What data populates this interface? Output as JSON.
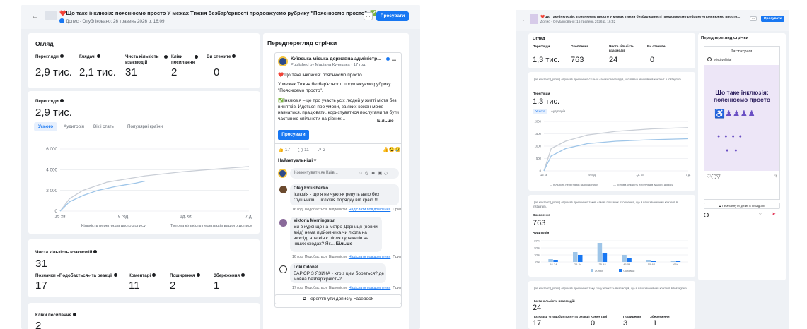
{
  "left": {
    "header": {
      "back": "←",
      "title": "❤️Що таке інклюзія: пояснюємо просто У межах Тижня безбар'єрності продовжуємо рубрику \"Пояснюємо просто\". ✅",
      "subtitle": "Допис · Опубліковано: 26 травень 2026 р. 16:09",
      "more": "...",
      "boost": "Просувати"
    },
    "overview": {
      "title": "Огляд",
      "metrics": [
        {
          "label": "Перегляди",
          "value": "2,9 тис."
        },
        {
          "label": "Глядачі",
          "value": "2,1 тис."
        },
        {
          "label": "Чиста кількість взаємодій",
          "value": "31"
        },
        {
          "label": "Кліки посилання",
          "value": "2"
        },
        {
          "label": "Ви стежите",
          "value": "0"
        }
      ]
    },
    "views_card": {
      "label": "Перегляди",
      "value": "2,9 тис.",
      "tabs": [
        "Усього",
        "Аудиторія",
        "Вік і стать",
        "Популярні країни"
      ],
      "active_tab": "Усього"
    },
    "chart_data": {
      "type": "line",
      "x_ticks": [
        "15 хв",
        "9 год",
        "1д. 6г.",
        "7 д."
      ],
      "y_ticks": [
        "0",
        "2 000",
        "4 000",
        "6 000"
      ],
      "ylim": [
        0,
        6000
      ],
      "series": [
        {
          "name": "Кількість переглядів цього допису",
          "color": "#9ec5e8",
          "x": [
            0,
            0.05,
            0.12,
            0.2,
            0.3,
            0.4,
            0.45
          ],
          "values": [
            0,
            900,
            1500,
            2000,
            2400,
            2700,
            2900
          ]
        },
        {
          "name": "Типова кількість переглядів вашого допису",
          "color": "#c9ced6",
          "x": [
            0,
            0.05,
            0.12,
            0.25,
            0.45,
            0.65,
            0.85,
            1.0
          ],
          "values": [
            0,
            1200,
            2000,
            2800,
            3400,
            3800,
            4100,
            4300
          ]
        }
      ]
    },
    "interactions": {
      "title": "Чиста кількість взаємодій",
      "value": "31",
      "metrics": [
        {
          "label": "Позначки «Подобається» та реакції",
          "value": "17"
        },
        {
          "label": "Коментарі",
          "value": "11"
        },
        {
          "label": "Поширення",
          "value": "2"
        },
        {
          "label": "Збереження",
          "value": "1"
        }
      ]
    },
    "link_clicks": {
      "title": "Кліки посилання",
      "value": "2"
    },
    "preview": {
      "title": "Передперегляд стрічки",
      "page_name": "Київська міська державна адміністр...",
      "published_by": "Published by Маріана Куницька",
      "time": "17 год.",
      "post_lines": [
        "❤️Що таке інклюзія: пояснюємо просто",
        "У межах Тижня безбар'єрності продовжуємо рубрику \"Пояснюємо просто\".",
        "✅Інклюзія – це про участь усіх людей у житті міста без винятків. Йдеться про умови, за яких кожен може навчатися, працювати, користуватися послугами та бути частиною спільноти на рівних..."
      ],
      "more_text": "Більше",
      "boost": "Просувати",
      "likes": "17",
      "comments": "11",
      "shares": "2",
      "sort": "Найактуальніші",
      "comment_placeholder": "Коментувати як Київ...",
      "comments_list": [
        {
          "name": "Oleg Evtushenko",
          "text": "Іклюзія - що я не чую як ревуть авто без глушників ... іклюзія порядку від краю !!!",
          "time": "16 год",
          "like": "Подобається",
          "reply": "Відповісти",
          "hide": "Надіслати повідомлення",
          "more": "Прих"
        },
        {
          "name": "Viktoria Morningstar",
          "text": "Ви в курсі що на метро Дарниця (новий вхід) нема підйомника чи ліфта на вихоід, але він є після турнікетів на інших сходах? Як...",
          "more_text": "Більше",
          "time": "16 год",
          "like": "Подобається",
          "reply": "Відповісти",
          "hide": "Надіслати повідомлення",
          "more": "Прих"
        },
        {
          "name": "Loki Odonel",
          "text": "БАР'ЄР З ЯЗИКА - хто з цим бореться? де мовна безбар'єрність?",
          "time": "17 год",
          "like": "Подобається",
          "reply": "Відповісти",
          "hide": "Надіслати повідомлення",
          "more": "Прих"
        }
      ],
      "view_on_fb": "Переглянути допис у Facebook"
    }
  },
  "right": {
    "header": {
      "title": "❤️Що таке інклюзія: пояснюємо просто У межах Тижня безбар'єрності продовжуємо рубрику «Пояснюємо просто...",
      "subtitle": "Допис · Опубліковано: 15 травень 2026 р. 16:32",
      "more": "...",
      "boost": "Просувати"
    },
    "overview": {
      "title": "Огляд",
      "metrics": [
        {
          "label": "Перегляди",
          "value": "1,3 тис."
        },
        {
          "label": "Охоплення",
          "value": "763"
        },
        {
          "label": "Чиста кількість взаємодій",
          "value": "24"
        },
        {
          "label": "Ви стежите",
          "value": "0"
        }
      ]
    },
    "views_card": {
      "note": "Цей контент (допис) отримав приблизно стільки самих переглядів, що й ваш звичайний контент в Instagram.",
      "label": "Перегляди",
      "value": "1,3 тис.",
      "tabs": [
        "Усього",
        "Аудиторія"
      ],
      "active_tab": "Усього"
    },
    "views_chart": {
      "type": "line",
      "x_ticks": [
        "15 хв",
        "9 год",
        "1д. 6г.",
        "7 д."
      ],
      "y_ticks": [
        "0",
        "500",
        "1000",
        "1500",
        "2000"
      ],
      "ylim": [
        0,
        2000
      ],
      "series": [
        {
          "name": "Кількість переглядів цього допису",
          "color": "#9ec5e8",
          "x": [
            0,
            0.05,
            0.15,
            0.3,
            0.5,
            0.75,
            1.0
          ],
          "values": [
            0,
            600,
            900,
            1100,
            1200,
            1260,
            1300
          ]
        },
        {
          "name": "Типова кількість переглядів вашого допису",
          "color": "#c9ced6",
          "x": [
            0,
            0.05,
            0.15,
            0.3,
            0.5,
            0.75,
            1.0
          ],
          "values": [
            0,
            900,
            1200,
            1450,
            1600,
            1700,
            1750
          ]
        }
      ]
    },
    "reach_card": {
      "note": "Цей контент (допис) отримав приблизно такий самий показник охоплення, що й ваш звичайний контент в Instagram.",
      "label": "Охоплення",
      "value": "763",
      "audience_label": "Аудиторія",
      "y_ticks": [
        "0%",
        "10%",
        "20%",
        "30%"
      ]
    },
    "reach_chart": {
      "type": "bar",
      "categories": [
        "18-24",
        "25-34",
        "35-44",
        "45-54",
        "55-64",
        "65+"
      ],
      "series": [
        {
          "name": "Жінки",
          "color": "#9ec5e8",
          "values": [
            4,
            14,
            27,
            10,
            3,
            1
          ]
        },
        {
          "name": "Чоловіки",
          "color": "#1877f2",
          "values": [
            3,
            10,
            12,
            6,
            2,
            1
          ]
        }
      ]
    },
    "interactions": {
      "note": "Цей контент (допис) отримав приблизно таку саму кількість взаємодій, що й ваш звичайний контент в Instagram.",
      "label": "Чиста кількість взаємодій",
      "value": "24",
      "metrics": [
        {
          "label": "Позначки «Подобається» та реакції",
          "value": "17"
        },
        {
          "label": "Коментарі",
          "value": "0"
        },
        {
          "label": "Поширення",
          "value": "3"
        },
        {
          "label": "Збереження",
          "value": "1"
        }
      ]
    },
    "preview": {
      "title": "Передперегляд стрічки",
      "ig_header": "Інстаграм",
      "username": "kyivcityofficial",
      "poster_title": "Що таке інклюзія: пояснюємо просто",
      "view_on_ig": "Переглянути допис в Instagram"
    }
  },
  "colors": {
    "accent": "#1877f2",
    "light_series": "#9ec5e8",
    "gray_series": "#c9ced6",
    "bg": "#edf0f4"
  }
}
